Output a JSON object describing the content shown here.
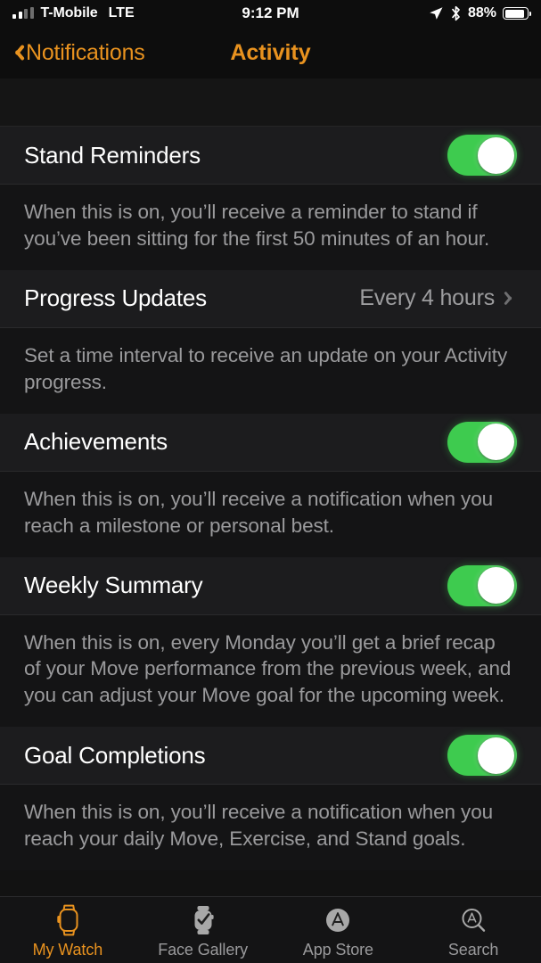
{
  "status_bar": {
    "carrier": "T-Mobile",
    "network": "LTE",
    "time": "9:12 PM",
    "battery_percent": "88%",
    "battery_level": 88,
    "icons": [
      "signal-bars-icon",
      "location-arrow-icon",
      "bluetooth-icon",
      "battery-icon"
    ]
  },
  "nav": {
    "back_label": "Notifications",
    "title": "Activity",
    "accent_color": "#e8921f"
  },
  "settings": {
    "accent_green": "#3ecb4f",
    "rows": [
      {
        "title": "Stand Reminders",
        "control": "toggle",
        "toggle_on": true,
        "description": "When this is on, you’ll receive a reminder to stand if you’ve been sitting for the first 50 minutes of an hour."
      },
      {
        "title": "Progress Updates",
        "control": "disclosure",
        "value": "Every 4 hours",
        "description": "Set a time interval to receive an update on your Activity progress."
      },
      {
        "title": "Achievements",
        "control": "toggle",
        "toggle_on": true,
        "description": "When this is on, you’ll receive a notification when you reach a milestone or personal best."
      },
      {
        "title": "Weekly Summary",
        "control": "toggle",
        "toggle_on": true,
        "description": "When this is on, every Monday you’ll get a brief recap of your Move performance from the previous week, and you can adjust your Move goal for the upcoming week."
      },
      {
        "title": "Goal Completions",
        "control": "toggle",
        "toggle_on": true,
        "description": "When this is on, you’ll receive a notification when you reach your daily Move, Exercise, and Stand goals."
      }
    ]
  },
  "tabbar": {
    "active_index": 0,
    "tabs": [
      {
        "label": "My Watch",
        "icon": "watch-icon"
      },
      {
        "label": "Face Gallery",
        "icon": "watch-face-check-icon"
      },
      {
        "label": "App Store",
        "icon": "app-store-icon"
      },
      {
        "label": "Search",
        "icon": "search-app-store-icon"
      }
    ]
  }
}
